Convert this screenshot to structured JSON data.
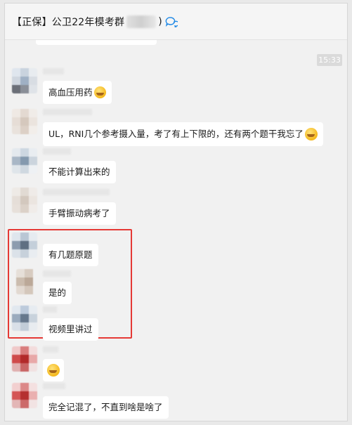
{
  "header": {
    "title": "【正保】公卫22年模考群",
    "close_paren": ")",
    "chat_icon": "chat-bubble-icon"
  },
  "timestamp": "15:33",
  "messages": [
    {
      "text": "高血压用药",
      "emoji": "laughing-tears-emoji"
    },
    {
      "text": "UL，RNI几个参考摄入量，考了有上下限的，还有两个题干我忘了",
      "emoji": "crying-emoji"
    },
    {
      "text": "不能计算出来的"
    },
    {
      "text": "手臂振动病考了"
    },
    {
      "text": "有几题原题"
    },
    {
      "text": "是的"
    },
    {
      "text": "视频里讲过"
    },
    {
      "text": "",
      "emoji": "crying-emoji"
    },
    {
      "text": "完全记混了，不直到啥是啥了"
    }
  ],
  "colors": {
    "highlight_border": "#e53935",
    "bubble_bg": "#ffffff",
    "chat_bg": "#f1f1f1",
    "accent": "#1e88e5"
  }
}
